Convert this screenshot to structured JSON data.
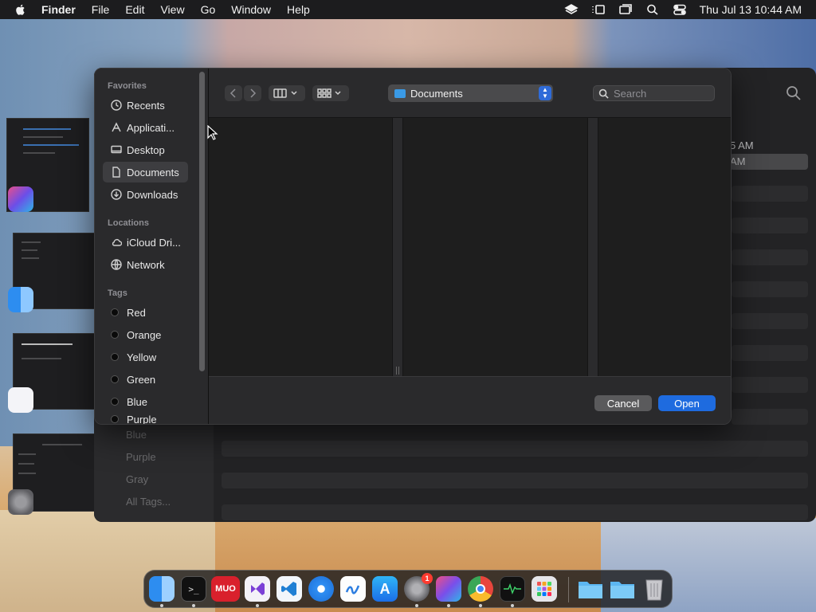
{
  "menubar": {
    "app_name": "Finder",
    "items": [
      "File",
      "Edit",
      "View",
      "Go",
      "Window",
      "Help"
    ],
    "clock": "Thu Jul 13  10:44 AM"
  },
  "background_window": {
    "times": [
      "5 AM",
      "AM"
    ],
    "tags": [
      "Blue",
      "Purple",
      "Gray",
      "All Tags..."
    ]
  },
  "dialog": {
    "sidebar": {
      "favorites_heading": "Favorites",
      "favorites": [
        {
          "label": "Recents",
          "icon": "clock-icon"
        },
        {
          "label": "Applicati...",
          "icon": "applications-icon"
        },
        {
          "label": "Desktop",
          "icon": "desktop-icon"
        },
        {
          "label": "Documents",
          "icon": "document-icon",
          "selected": true
        },
        {
          "label": "Downloads",
          "icon": "download-icon"
        }
      ],
      "locations_heading": "Locations",
      "locations": [
        {
          "label": "iCloud Dri...",
          "icon": "cloud-icon"
        },
        {
          "label": "Network",
          "icon": "globe-icon"
        }
      ],
      "tags_heading": "Tags",
      "tags": [
        "Red",
        "Orange",
        "Yellow",
        "Green",
        "Blue",
        "Purple"
      ]
    },
    "toolbar": {
      "location": "Documents",
      "search_placeholder": "Search"
    },
    "footer": {
      "cancel_label": "Cancel",
      "open_label": "Open"
    }
  },
  "dock": {
    "apps": [
      "Finder",
      "Terminal",
      "MUO",
      "Visual Studio",
      "VS Code",
      "Safari",
      "Freeform",
      "App Store",
      "System Settings",
      "Shortcuts",
      "Chrome",
      "Activity Monitor",
      "Launchpad",
      "Folder",
      "Folder",
      "Trash"
    ],
    "system_settings_badge": "1"
  },
  "colors": {
    "accent": "#1e6bdf",
    "dialog_bg": "#1e1e1e",
    "sidebar_bg": "#2a2a2c"
  }
}
